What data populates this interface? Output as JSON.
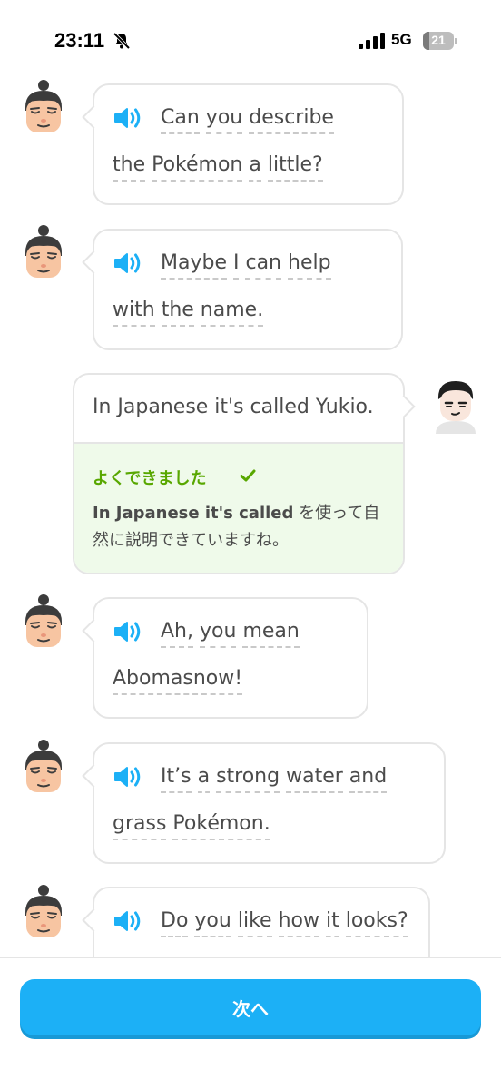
{
  "status_bar": {
    "time": "23:11",
    "network": "5G",
    "battery": "21",
    "battery_level": 0.21
  },
  "messages": [
    {
      "lines": [
        [
          "Can",
          "you",
          "describe"
        ],
        [
          "the",
          "Pokémon",
          "a",
          "little?"
        ]
      ]
    },
    {
      "lines": [
        [
          "Maybe",
          "I",
          "can",
          "help"
        ],
        [
          "with",
          "the",
          "name."
        ]
      ]
    },
    {
      "text": "In Japanese it's called Yukio.",
      "feedback": {
        "title": "よくできました",
        "bold": "In Japanese it's called",
        "rest": " を使って自然に説明できていますね。"
      }
    },
    {
      "lines": [
        [
          "Ah,",
          "you",
          "mean"
        ],
        [
          "Abomasnow!"
        ]
      ]
    },
    {
      "lines": [
        [
          "It’s",
          "a",
          "strong",
          "water",
          "and"
        ],
        [
          "grass",
          "Pokémon."
        ]
      ]
    },
    {
      "lines": [
        [
          "Do",
          "you",
          "like",
          "how",
          "it",
          "looks?"
        ]
      ]
    }
  ],
  "next_button": {
    "label": "次へ"
  },
  "colors": {
    "accent": "#1cb0f6",
    "success": "#58a700",
    "feedback_bg": "#effaea"
  },
  "icons": [
    "silent-bell-icon",
    "cellular-signal-icon",
    "battery-icon",
    "speaker-icon",
    "checkmark-icon",
    "tutor-avatar",
    "user-avatar"
  ]
}
